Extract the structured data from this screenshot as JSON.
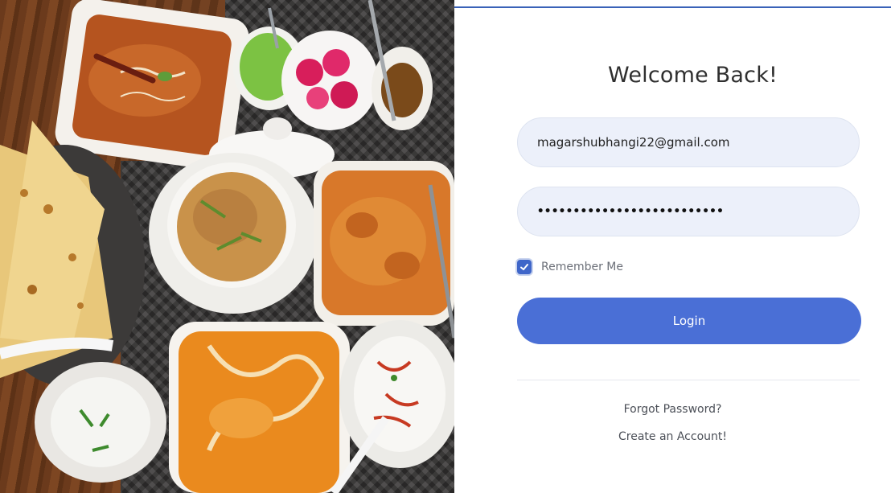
{
  "login": {
    "title": "Welcome Back!",
    "email_value": "magarshubhangi22@gmail.com",
    "password_mask": "••••••••••••••••••••••••••",
    "remember_label": "Remember Me",
    "remember_checked": true,
    "login_button": "Login",
    "forgot_link": "Forgot Password?",
    "create_link": "Create an Account!"
  },
  "colors": {
    "accent": "#4a6fd6",
    "field_bg": "#ecf0fa",
    "checkbox": "#3f66c9"
  },
  "image": {
    "subject": "food-photo"
  }
}
